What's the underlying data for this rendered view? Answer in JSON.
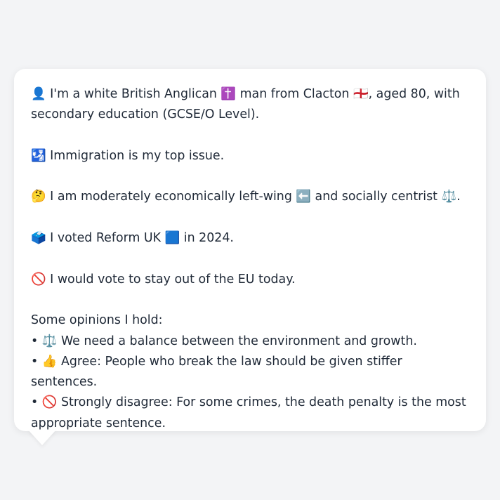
{
  "profile": {
    "identity_line": "👤 I'm a white British Anglican ✝️ man from Clacton 🏴󠁧󠁢󠁥󠁮󠁧󠁿, aged 80, with secondary education (GCSE/O Level).",
    "issue_line": "🛂 Immigration is my top issue.",
    "ideology_line": "🤔 I am moderately economically left-wing ⬅️ and socially centrist ⚖️.",
    "vote_line": "🗳️ I voted Reform UK 🟦 in 2024.",
    "eu_line": "🚫 I would vote to stay out of the EU today."
  },
  "opinions": {
    "heading": "Some opinions I hold:",
    "items": [
      "• ⚖️ We need a balance between the environment and growth.",
      "• 👍 Agree: People who break the law should be given stiffer sentences.",
      "• 🚫 Strongly disagree: For some crimes, the death penalty is the most appropriate sentence."
    ]
  }
}
